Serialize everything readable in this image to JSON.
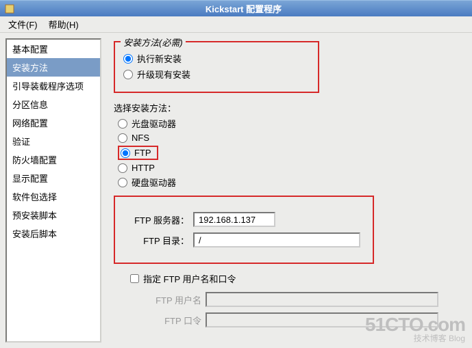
{
  "window": {
    "title": "Kickstart 配置程序"
  },
  "menubar": {
    "file": "文件(F)",
    "help": "帮助(H)"
  },
  "sidebar": {
    "items": [
      {
        "label": "基本配置"
      },
      {
        "label": "安装方法"
      },
      {
        "label": "引导装载程序选项"
      },
      {
        "label": "分区信息"
      },
      {
        "label": "网络配置"
      },
      {
        "label": "验证"
      },
      {
        "label": "防火墙配置"
      },
      {
        "label": "显示配置"
      },
      {
        "label": "软件包选择"
      },
      {
        "label": "预安装脚本"
      },
      {
        "label": "安装后脚本"
      }
    ],
    "selectedIndex": 1
  },
  "installType": {
    "legend": "安装方法(必需)",
    "newInstall": "执行新安装",
    "upgrade": "升级现有安装",
    "selected": "newInstall"
  },
  "installMethod": {
    "label": "选择安装方法：",
    "options": {
      "cdrom": "光盘驱动器",
      "nfs": "NFS",
      "ftp": "FTP",
      "http": "HTTP",
      "hd": "硬盘驱动器"
    },
    "selected": "ftp"
  },
  "ftp": {
    "serverLabel": "FTP 服务器：",
    "serverValue": "192.168.1.137",
    "dirLabel": "FTP 目录：",
    "dirValue": "/",
    "authCheck": "指定 FTP 用户名和口令",
    "userLabel": "FTP 用户名",
    "passLabel": "FTP 口令"
  },
  "watermark": {
    "big": "51CTO.com",
    "small": "技术博客   Blog"
  }
}
